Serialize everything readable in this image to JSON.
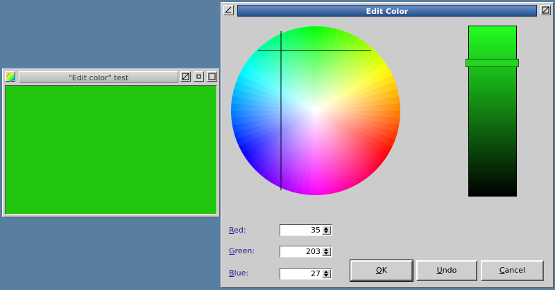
{
  "test_window": {
    "title": "\"Edit color\" test",
    "client_color": "#23c60f"
  },
  "edit_window": {
    "title": "Edit Color",
    "selected_color": "#23cb1b",
    "fields": [
      {
        "label": "Red",
        "accel": "R",
        "rest": "ed:",
        "value": "35"
      },
      {
        "label": "Green",
        "accel": "G",
        "rest": "reen:",
        "value": "203"
      },
      {
        "label": "Blue",
        "accel": "B",
        "rest": "lue:",
        "value": "27"
      }
    ],
    "buttons": {
      "ok": {
        "accel": "O",
        "rest": "K"
      },
      "undo": {
        "accel": "U",
        "rest": "ndo"
      },
      "cancel": {
        "accel": "C",
        "rest": "ancel"
      }
    }
  }
}
